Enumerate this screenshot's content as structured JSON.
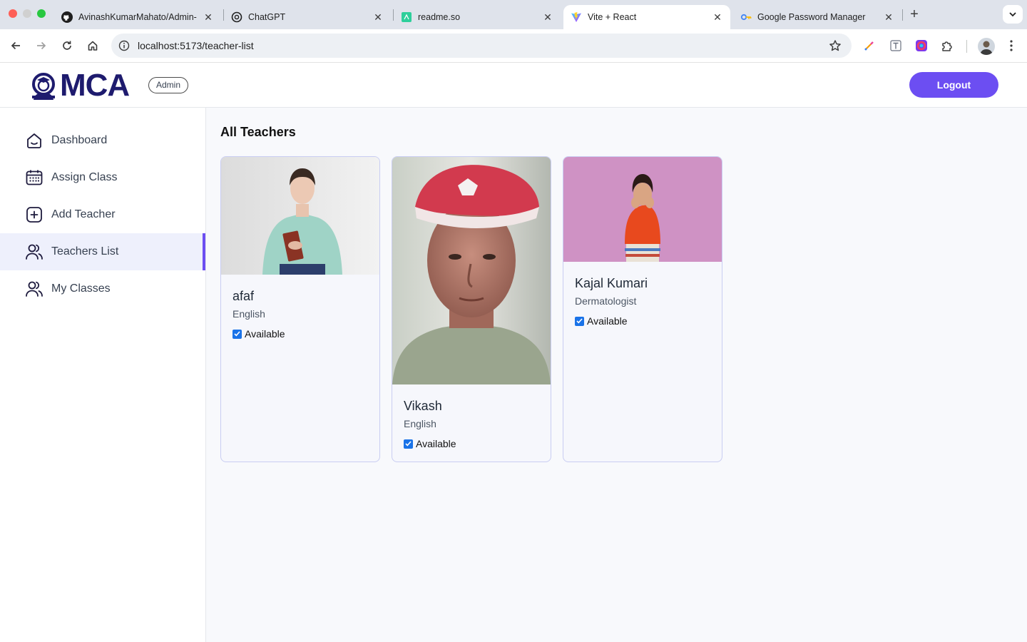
{
  "browser": {
    "tabs": [
      {
        "title": "AvinashKumarMahato/Admin-",
        "icon": "github-icon"
      },
      {
        "title": "ChatGPT",
        "icon": "chatgpt-icon"
      },
      {
        "title": "readme.so",
        "icon": "readme-icon"
      },
      {
        "title": "Vite + React",
        "icon": "vite-icon",
        "active": true
      },
      {
        "title": "Google Password Manager",
        "icon": "password-manager-icon"
      }
    ],
    "url": "localhost:5173/teacher-list"
  },
  "header": {
    "logo_text": "MCA",
    "role_badge": "Admin",
    "logout_label": "Logout"
  },
  "sidebar": {
    "items": [
      {
        "label": "Dashboard",
        "icon": "home-icon"
      },
      {
        "label": "Assign Class",
        "icon": "calendar-icon"
      },
      {
        "label": "Add Teacher",
        "icon": "add-box-icon"
      },
      {
        "label": "Teachers List",
        "icon": "users-icon",
        "active": true
      },
      {
        "label": "My Classes",
        "icon": "users-icon"
      }
    ]
  },
  "main": {
    "title": "All Teachers",
    "teachers": [
      {
        "name": "afaf",
        "subject": "English",
        "available_label": "Available",
        "available": true
      },
      {
        "name": "Vikash",
        "subject": "English",
        "available_label": "Available",
        "available": true
      },
      {
        "name": "Kajal Kumari",
        "subject": "Dermatologist",
        "available_label": "Available",
        "available": true
      }
    ]
  },
  "colors": {
    "accent": "#6c4ef2",
    "logo": "#1e1b6e",
    "checkbox": "#1a73e8",
    "card_border": "#c9cdf2"
  }
}
